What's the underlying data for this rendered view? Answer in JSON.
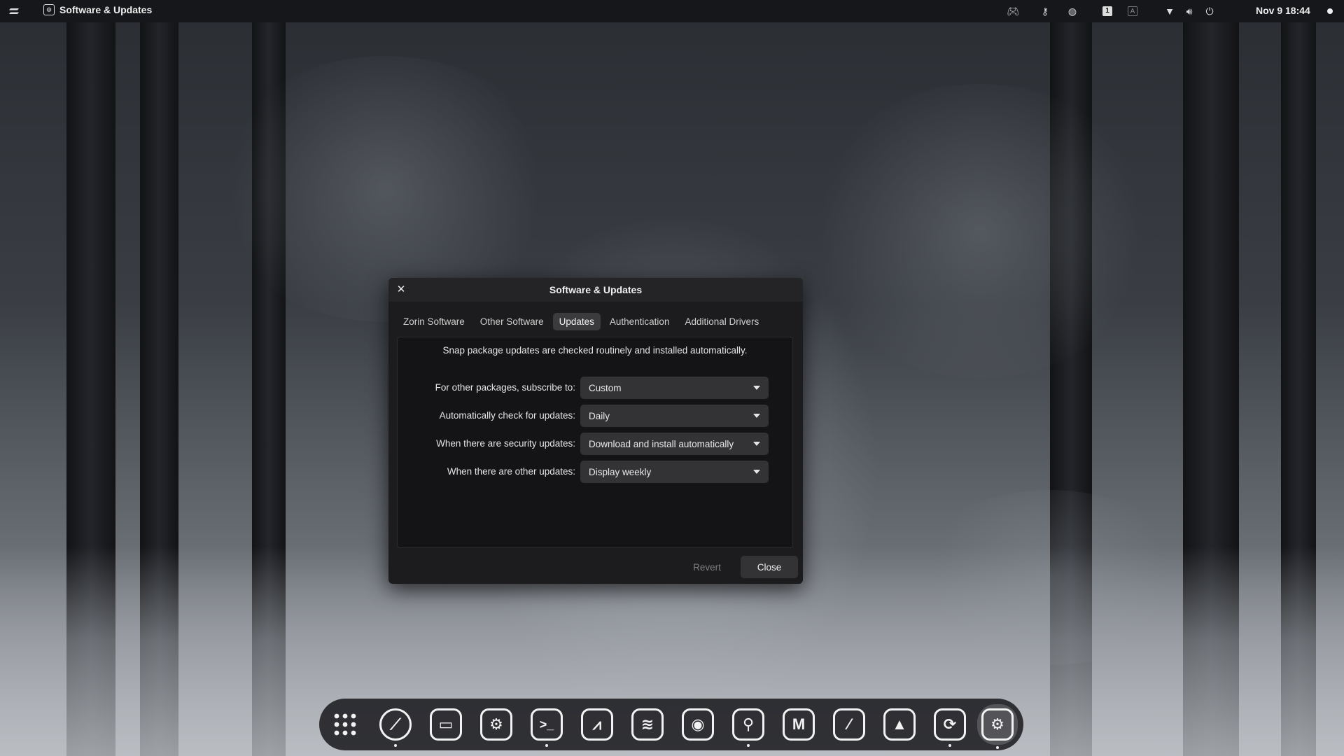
{
  "topbar": {
    "app_title": "Software & Updates",
    "clock": "Nov 9  18:44",
    "tray_icons": [
      "gamepad-icon",
      "key-icon",
      "messenger-icon",
      "keyboard-layout-icon",
      "input-method-icon",
      "wifi-icon",
      "volume-icon",
      "power-icon"
    ]
  },
  "dialog": {
    "title": "Software & Updates",
    "tabs": [
      {
        "label": "Zorin Software"
      },
      {
        "label": "Other Software"
      },
      {
        "label": "Updates"
      },
      {
        "label": "Authentication"
      },
      {
        "label": "Additional Drivers"
      }
    ],
    "active_tab": "Updates",
    "notice": "Snap package updates are checked routinely and installed automatically.",
    "rows": [
      {
        "label": "For other packages, subscribe to:",
        "value": "Custom"
      },
      {
        "label": "Automatically check for updates:",
        "value": "Daily"
      },
      {
        "label": "When there are security updates:",
        "value": "Download and install automatically"
      },
      {
        "label": "When there are other updates:",
        "value": "Display weekly"
      }
    ],
    "revert_label": "Revert",
    "close_label": "Close"
  },
  "dock": {
    "items": [
      {
        "icon": "app-grid-icon",
        "running": false
      },
      {
        "icon": "browser-compass-icon",
        "running": true
      },
      {
        "icon": "window-icon",
        "running": false
      },
      {
        "icon": "settings-tools-icon",
        "running": false
      },
      {
        "icon": "terminal-icon",
        "running": true
      },
      {
        "icon": "drawing-app-icon",
        "running": false
      },
      {
        "icon": "spotify-icon",
        "running": false
      },
      {
        "icon": "speaker-icon",
        "running": false
      },
      {
        "icon": "steam-icon",
        "running": true
      },
      {
        "icon": "mastodon-icon",
        "running": false
      },
      {
        "icon": "brush-icon",
        "running": false
      },
      {
        "icon": "inkscape-icon",
        "running": false
      },
      {
        "icon": "sync-icon",
        "running": true
      },
      {
        "icon": "software-updates-icon",
        "running": true,
        "active": true
      }
    ]
  }
}
